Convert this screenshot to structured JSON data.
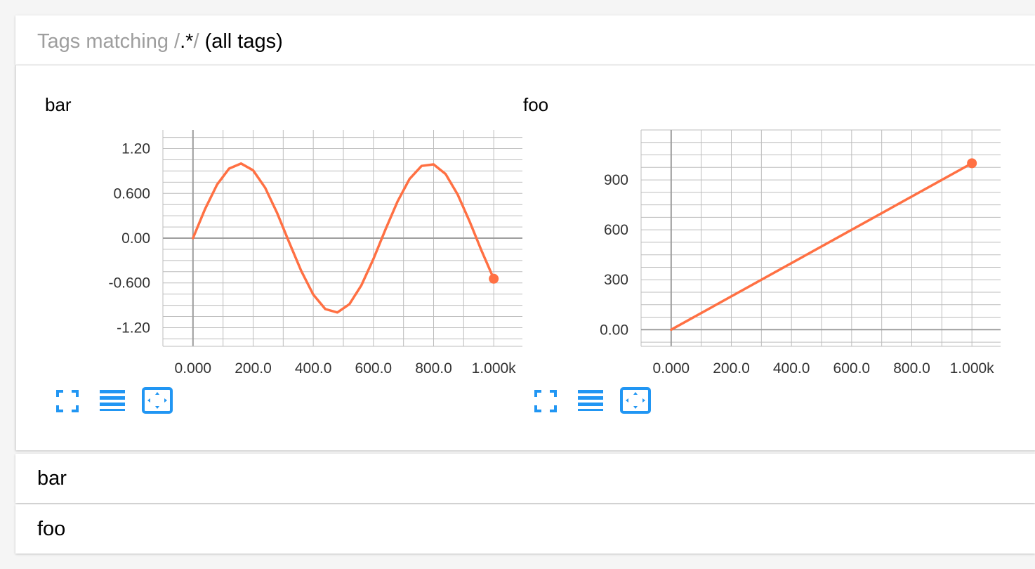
{
  "header": {
    "prefix": "Tags matching ",
    "slash_open": "/",
    "pattern": ".*",
    "slash_close": "/",
    "suffix": " (all tags)"
  },
  "cards": [
    {
      "title": "bar",
      "buttons": [
        "fullscreen-icon",
        "list-icon",
        "fit-domain-icon"
      ]
    },
    {
      "title": "foo",
      "buttons": [
        "fullscreen-icon",
        "list-icon",
        "fit-domain-icon"
      ]
    }
  ],
  "rows": [
    {
      "label": "bar"
    },
    {
      "label": "foo"
    }
  ],
  "colors": {
    "series": "#ff7043",
    "accent": "#2196f3",
    "grid": "#bdbdbd",
    "axis": "#9e9e9e"
  },
  "chart_data": [
    {
      "type": "line",
      "title": "bar",
      "xlabel": "",
      "ylabel": "",
      "xlim": [
        -100,
        1100
      ],
      "ylim": [
        -1.45,
        1.45
      ],
      "x_ticks": [
        0,
        200,
        400,
        600,
        800,
        1000
      ],
      "x_tick_labels": [
        "0.000",
        "200.0",
        "400.0",
        "600.0",
        "800.0",
        "1.000k"
      ],
      "y_ticks": [
        1.2,
        0.6,
        0,
        -0.6,
        -1.2
      ],
      "y_tick_labels": [
        "1.20",
        "0.600",
        "0.00",
        "-0.600",
        "-1.20"
      ],
      "grid": true,
      "series": [
        {
          "x": [
            0,
            40,
            80,
            120,
            160,
            200,
            240,
            280,
            320,
            360,
            400,
            440,
            480,
            520,
            560,
            600,
            640,
            680,
            720,
            760,
            800,
            840,
            880,
            920,
            960,
            1000
          ],
          "y": [
            0.0,
            0.389,
            0.717,
            0.932,
            1.0,
            0.909,
            0.675,
            0.335,
            -0.058,
            -0.44,
            -0.757,
            -0.951,
            -0.996,
            -0.886,
            -0.631,
            -0.279,
            0.116,
            0.49,
            0.793,
            0.968,
            0.989,
            0.859,
            0.585,
            0.222,
            -0.174,
            -0.544
          ]
        }
      ]
    },
    {
      "type": "line",
      "title": "foo",
      "xlabel": "",
      "ylabel": "",
      "xlim": [
        -100,
        1100
      ],
      "ylim": [
        -100,
        1200
      ],
      "x_ticks": [
        0,
        200,
        400,
        600,
        800,
        1000
      ],
      "x_tick_labels": [
        "0.000",
        "200.0",
        "400.0",
        "600.0",
        "800.0",
        "1.000k"
      ],
      "y_ticks": [
        900,
        600,
        300,
        0
      ],
      "y_tick_labels": [
        "900",
        "600",
        "300",
        "0.00"
      ],
      "grid": true,
      "series": [
        {
          "x": [
            0,
            1000
          ],
          "y": [
            0,
            1000
          ]
        }
      ]
    }
  ]
}
